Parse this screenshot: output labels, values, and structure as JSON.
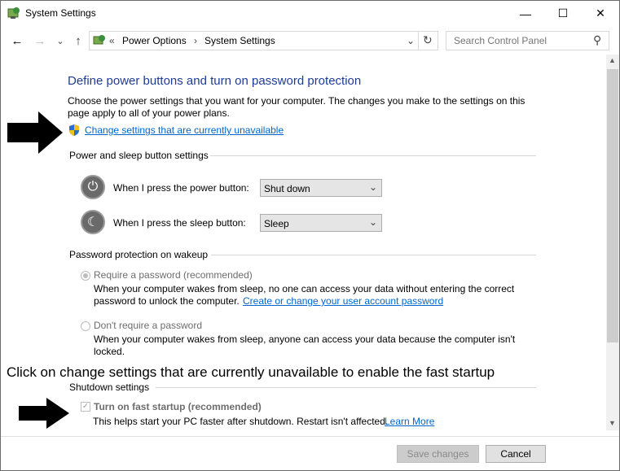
{
  "window": {
    "title": "System Settings",
    "minimize_glyph": "—",
    "maximize_glyph": "☐",
    "close_glyph": "✕"
  },
  "nav": {
    "back_glyph": "←",
    "forward_glyph": "→",
    "recent_glyph": "⌄",
    "up_glyph": "↑",
    "breadcrumb_sep_start": "«",
    "breadcrumbs": [
      "Power Options",
      "System Settings"
    ],
    "breadcrumb_sep": "›",
    "dropdown_glyph": "⌄",
    "refresh_glyph": "↻",
    "search_placeholder": "Search Control Panel",
    "search_glyph": "⚲"
  },
  "main": {
    "heading": "Define power buttons and turn on password protection",
    "intro_line1": "Choose the power settings that you want for your computer. The changes you make to the settings on this",
    "intro_line2": "page apply to all of your power plans.",
    "change_settings_link": "Change settings that are currently unavailable",
    "power_sleep_section": "Power and sleep button settings",
    "power_button_label": "When I press the power button:",
    "power_button_value": "Shut down",
    "sleep_button_label": "When I press the sleep button:",
    "sleep_button_value": "Sleep",
    "password_section": "Password protection on wakeup",
    "require_password_label": "Require a password (recommended)",
    "require_password_desc1": "When your computer wakes from sleep, no one can access your data without entering the correct",
    "require_password_desc2_prefix": "password to unlock the computer.",
    "require_password_link": "Create or change your user account password",
    "no_password_label": "Don't require a password",
    "no_password_desc1": "When your computer wakes from sleep, anyone can access your data because the computer isn't",
    "no_password_desc2": "locked.",
    "shutdown_section": "Shutdown settings",
    "fast_startup_label": "Turn on fast startup (recommended)",
    "fast_startup_desc": "This helps start your PC faster after shutdown. Restart isn't affected.",
    "learn_more_link": "Learn More",
    "check_glyph": "✓"
  },
  "annotation": {
    "caption": "Click on change settings that are currently unavailable to enable the fast startup"
  },
  "footer": {
    "save_label": "Save changes",
    "cancel_label": "Cancel"
  },
  "colors": {
    "heading": "#1e3c96",
    "link": "#0066cc",
    "disabled_text": "#6d6d6d"
  }
}
